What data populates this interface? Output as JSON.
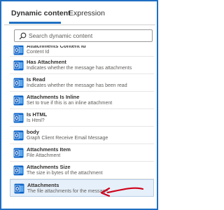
{
  "tabs": [
    {
      "label": "Dynamic content",
      "active": true
    },
    {
      "label": "Expression",
      "active": false
    }
  ],
  "search": {
    "placeholder": "Search dynamic content"
  },
  "items": [
    {
      "title": "Attachments Content Id",
      "desc": "Content Id",
      "icon": "outlook-icon"
    },
    {
      "title": "Has Attachment",
      "desc": "Indicates whether the message has attachments",
      "icon": "outlook-icon"
    },
    {
      "title": "Is Read",
      "desc": "Indicates whether the message has been read",
      "icon": "outlook-icon"
    },
    {
      "title": "Attachments Is Inline",
      "desc": "Set to true if this is an inline attachment",
      "icon": "outlook-icon"
    },
    {
      "title": "Is HTML",
      "desc": "Is Html?",
      "icon": "outlook-icon"
    },
    {
      "title": "body",
      "desc": "Graph Client Receive Email Message",
      "icon": "outlook-icon"
    },
    {
      "title": "Attachments Item",
      "desc": "File Attachment",
      "icon": "outlook-icon"
    },
    {
      "title": "Attachments Size",
      "desc": "The size in bytes of the attachment",
      "icon": "outlook-icon"
    },
    {
      "title": "Attachments",
      "desc": "The file attachments for the message",
      "icon": "outlook-icon",
      "highlighted": true
    }
  ],
  "colors": {
    "accent": "#1f6fc2",
    "outlook_blue": "#0a64c8",
    "annotation_red": "#d0021b",
    "highlight": "#e6f0fa"
  },
  "annotation": {
    "icon": "red-arrow-icon"
  }
}
